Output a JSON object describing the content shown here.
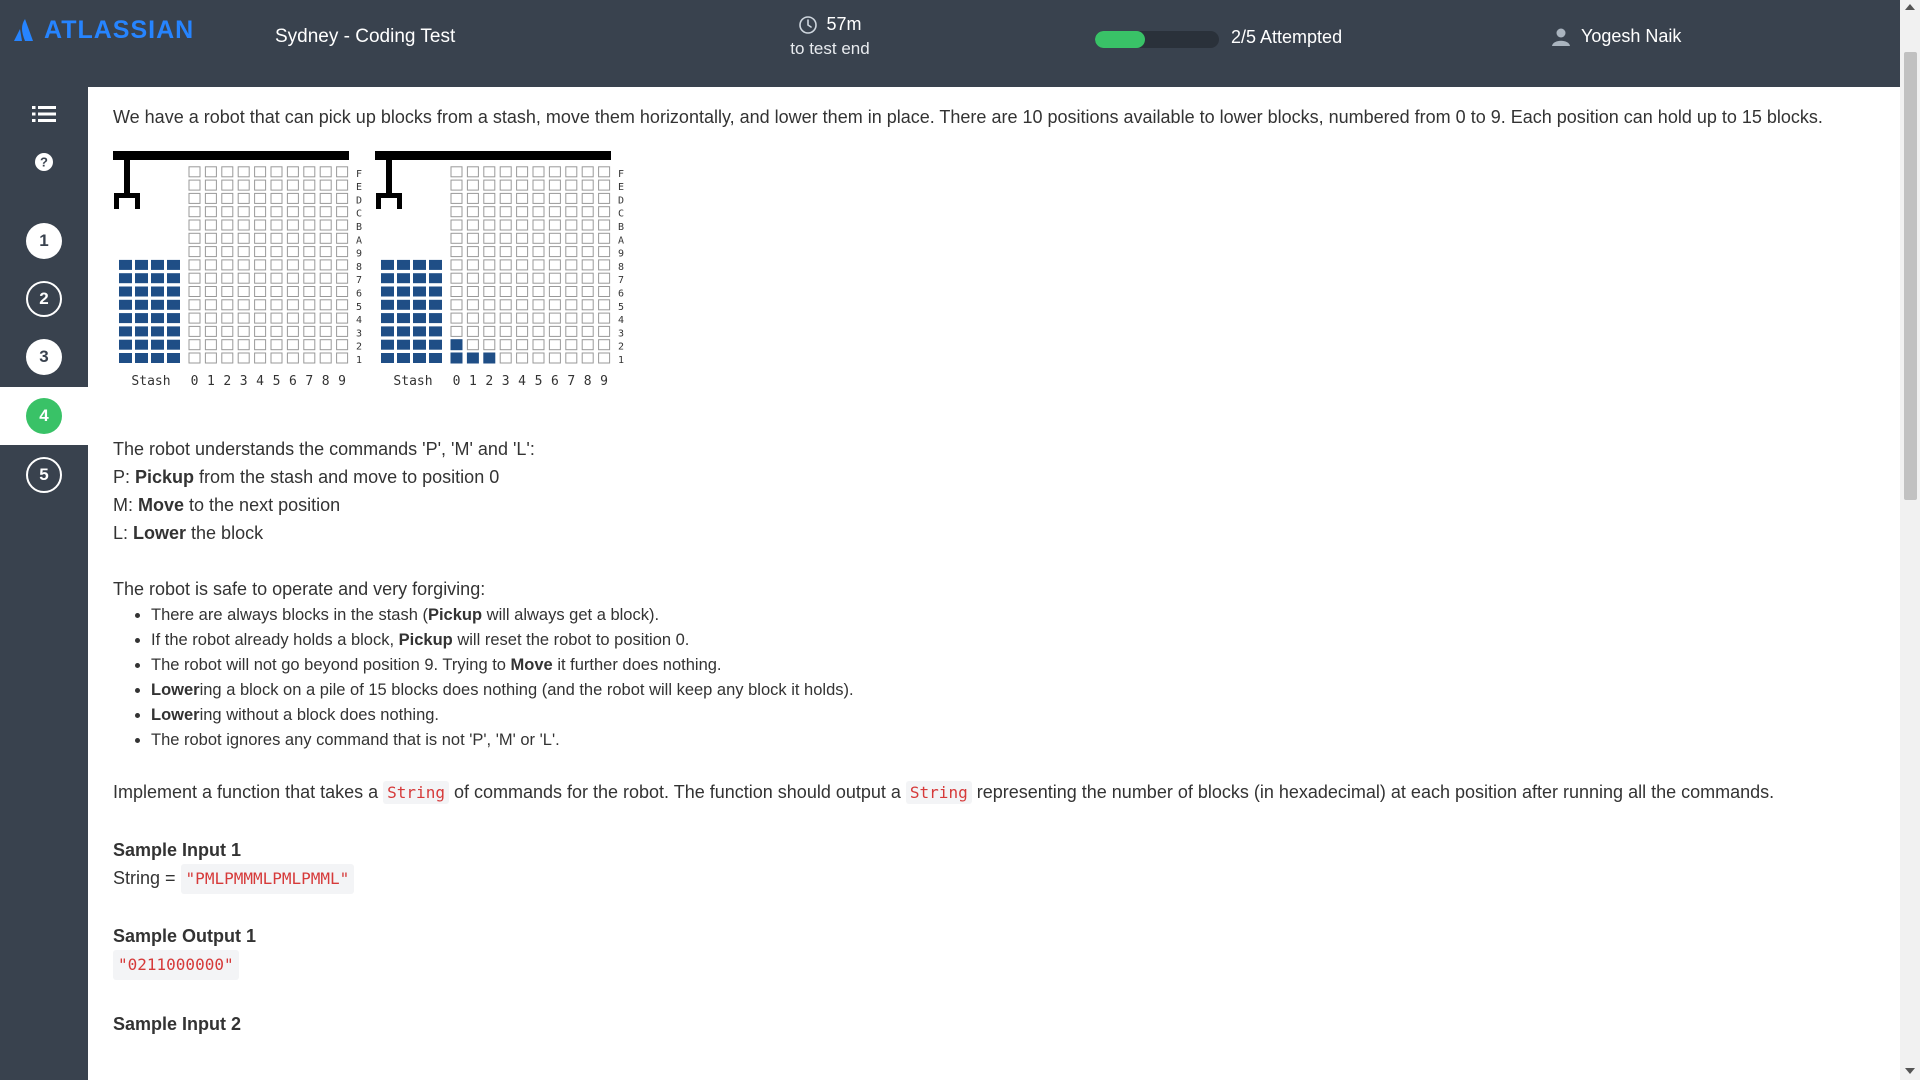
{
  "header": {
    "logo_text": "ATLASSIAN",
    "test_name": "Sydney - Coding Test",
    "timer_value": "57m",
    "timer_caption": "to test end",
    "progress_fraction": 0.4,
    "attempted": "2/5 Attempted",
    "user_name": "Yogesh Naik"
  },
  "sidebar": {
    "menu_icon": "list-icon",
    "help_icon": "question-icon",
    "questions": [
      {
        "label": "1",
        "state": "done"
      },
      {
        "label": "2",
        "state": "open"
      },
      {
        "label": "3",
        "state": "done"
      },
      {
        "label": "4",
        "state": "active"
      },
      {
        "label": "5",
        "state": "open"
      }
    ]
  },
  "problem": {
    "intro": "We have a robot that can pick up blocks from a stash, move them horizontally, and lower them in place. There are 10 positions available to lower blocks, numbered from 0 to 9. Each position can hold up to 15 blocks.",
    "figure": {
      "stash_label": "Stash",
      "position_labels": [
        "0",
        "1",
        "2",
        "3",
        "4",
        "5",
        "6",
        "7",
        "8",
        "9"
      ],
      "level_labels": [
        "F",
        "E",
        "D",
        "C",
        "B",
        "A",
        "9",
        "8",
        "7",
        "6",
        "5",
        "4",
        "3",
        "2",
        "1"
      ],
      "left_heights": [
        0,
        0,
        0,
        0,
        0,
        0,
        0,
        0,
        0,
        0
      ],
      "right_heights": [
        2,
        1,
        1,
        0,
        0,
        0,
        0,
        0,
        0,
        0
      ],
      "block_color": "#1f4e86"
    },
    "commands_intro": "The robot understands the commands 'P', 'M' and 'L':",
    "commands": [
      {
        "prefix": "P: ",
        "bold": "Pickup",
        "rest": " from the stash and move to position 0"
      },
      {
        "prefix": "M: ",
        "bold": "Move",
        "rest": " to the next position"
      },
      {
        "prefix": "L: ",
        "bold": "Lower",
        "rest": " the block"
      }
    ],
    "safe_intro": "The robot is safe to operate and very forgiving:",
    "bullets": [
      {
        "a": "There are always blocks in the stash (",
        "b": "Pickup",
        "c": " will always get a block)."
      },
      {
        "a": "If the robot already holds a block, ",
        "b": "Pickup",
        "c": " will reset the robot to position 0."
      },
      {
        "a": "The robot will not go beyond position 9. Trying to ",
        "b": "Move",
        "c": " it further does nothing."
      },
      {
        "a": "",
        "b": "Lower",
        "c": "ing a block on a pile of 15 blocks does nothing (and the robot will keep any block it holds)."
      },
      {
        "a": "",
        "b": "Lower",
        "c": "ing without a block does nothing."
      },
      {
        "a": "The robot ignores any command that is not 'P', 'M' or 'L'.",
        "b": "",
        "c": ""
      }
    ],
    "impl_1": "Implement a function that takes a ",
    "impl_code_1": "String",
    "impl_2": " of commands for the robot. The function should output a ",
    "impl_code_2": "String",
    "impl_3": " representing the number of blocks (in hexadecimal) at each position after running all the commands.",
    "sample_input_1_heading": "Sample Input 1",
    "sample_input_1_prefix": "String = ",
    "sample_input_1_value": "\"PMLPMMMLPMLPMML\"",
    "sample_output_1_heading": "Sample Output 1",
    "sample_output_1_value": "\"0211000000\"",
    "sample_input_2_heading": "Sample Input 2"
  }
}
